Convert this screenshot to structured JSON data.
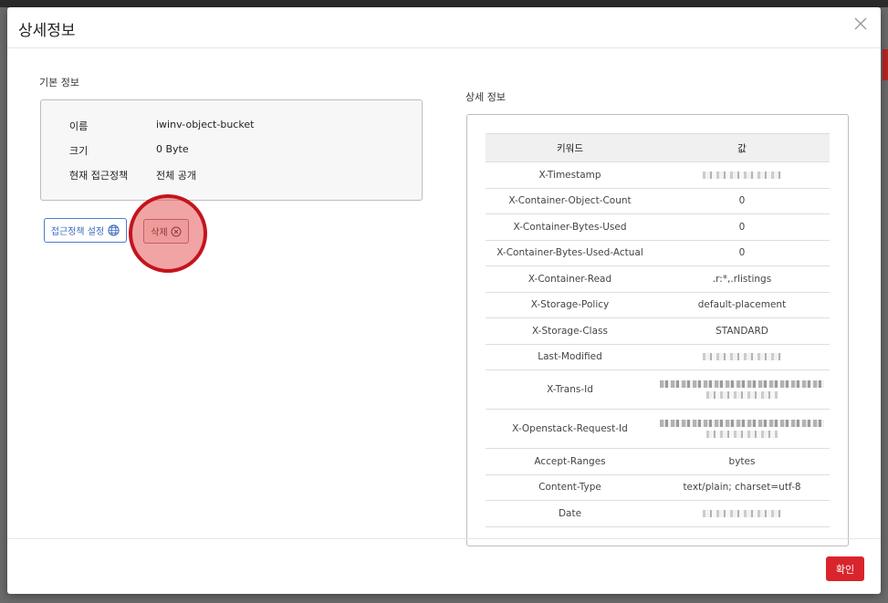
{
  "modal": {
    "title": "상세정보",
    "ok_label": "확인"
  },
  "basic_info": {
    "section_label": "기본 정보",
    "rows": [
      {
        "key": "이름",
        "value": "iwinv-object-bucket"
      },
      {
        "key": "크기",
        "value": "0 Byte"
      },
      {
        "key": "현재 접근정책",
        "value": "전체 공개"
      }
    ],
    "policy_button_label": "접근정책 설정",
    "delete_button_label": "삭제"
  },
  "detail_info": {
    "section_label": "상세 정보",
    "headers": {
      "keyword": "키워드",
      "value": "값"
    },
    "rows": [
      {
        "key": "X-Timestamp",
        "value": "",
        "masked": true
      },
      {
        "key": "X-Container-Object-Count",
        "value": "0"
      },
      {
        "key": "X-Container-Bytes-Used",
        "value": "0"
      },
      {
        "key": "X-Container-Bytes-Used-Actual",
        "value": "0"
      },
      {
        "key": "X-Container-Read",
        "value": ".r:*,.rlistings"
      },
      {
        "key": "X-Storage-Policy",
        "value": "default-placement"
      },
      {
        "key": "X-Storage-Class",
        "value": "STANDARD"
      },
      {
        "key": "Last-Modified",
        "value": "",
        "masked": true
      },
      {
        "key": "X-Trans-Id",
        "value": "",
        "masked": true,
        "two_line": true
      },
      {
        "key": "X-Openstack-Request-Id",
        "value": "",
        "masked": true,
        "two_line": true
      },
      {
        "key": "Accept-Ranges",
        "value": "bytes"
      },
      {
        "key": "Content-Type",
        "value": "text/plain; charset=utf-8"
      },
      {
        "key": "Date",
        "value": "",
        "masked": true
      }
    ]
  },
  "colors": {
    "accent_red": "#d9242c",
    "link_blue": "#3a6bbf"
  },
  "icons": [
    "close-icon",
    "globe-icon",
    "x-circle-icon"
  ]
}
